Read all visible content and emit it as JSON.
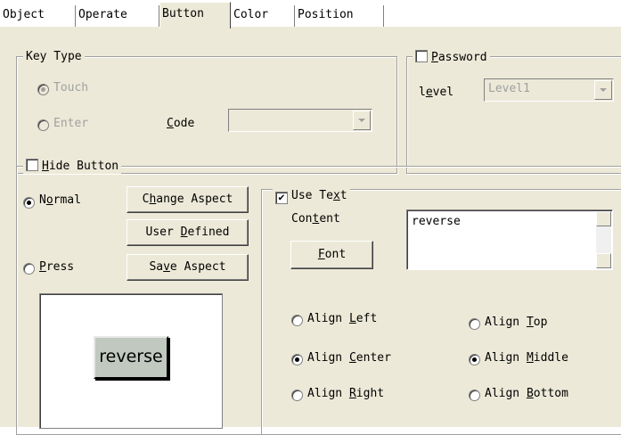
{
  "tabs": [
    "Object",
    "Operate",
    "Button",
    "Color",
    "Position"
  ],
  "key_type": {
    "legend": "Key Type",
    "touch": {
      "label": "Touch",
      "selected": true
    },
    "enter": {
      "label": "Enter",
      "selected": false
    },
    "code_label": "Code",
    "code_value": ""
  },
  "password": {
    "label": "Password",
    "checked": false,
    "level_label": "level",
    "level_value": "Level1"
  },
  "hide_button": {
    "label": "Hide Button",
    "checked": false
  },
  "normal_label": "Normal",
  "press_label": "Press",
  "change_aspect": "Change Aspect",
  "user_defined": "User Defined",
  "save_aspect": "Save Aspect",
  "preview_text": "reverse",
  "use_text": {
    "label": "Use Text",
    "checked": true
  },
  "content_label": "Content",
  "content_value": "reverse",
  "font_label": "Font",
  "align": {
    "left": "Align Left",
    "center": "Align Center",
    "right": "Align Right",
    "top": "Align Top",
    "middle": "Align Middle",
    "bottom": "Align Bottom",
    "horizontal_selected": "center",
    "vertical_selected": "middle"
  }
}
